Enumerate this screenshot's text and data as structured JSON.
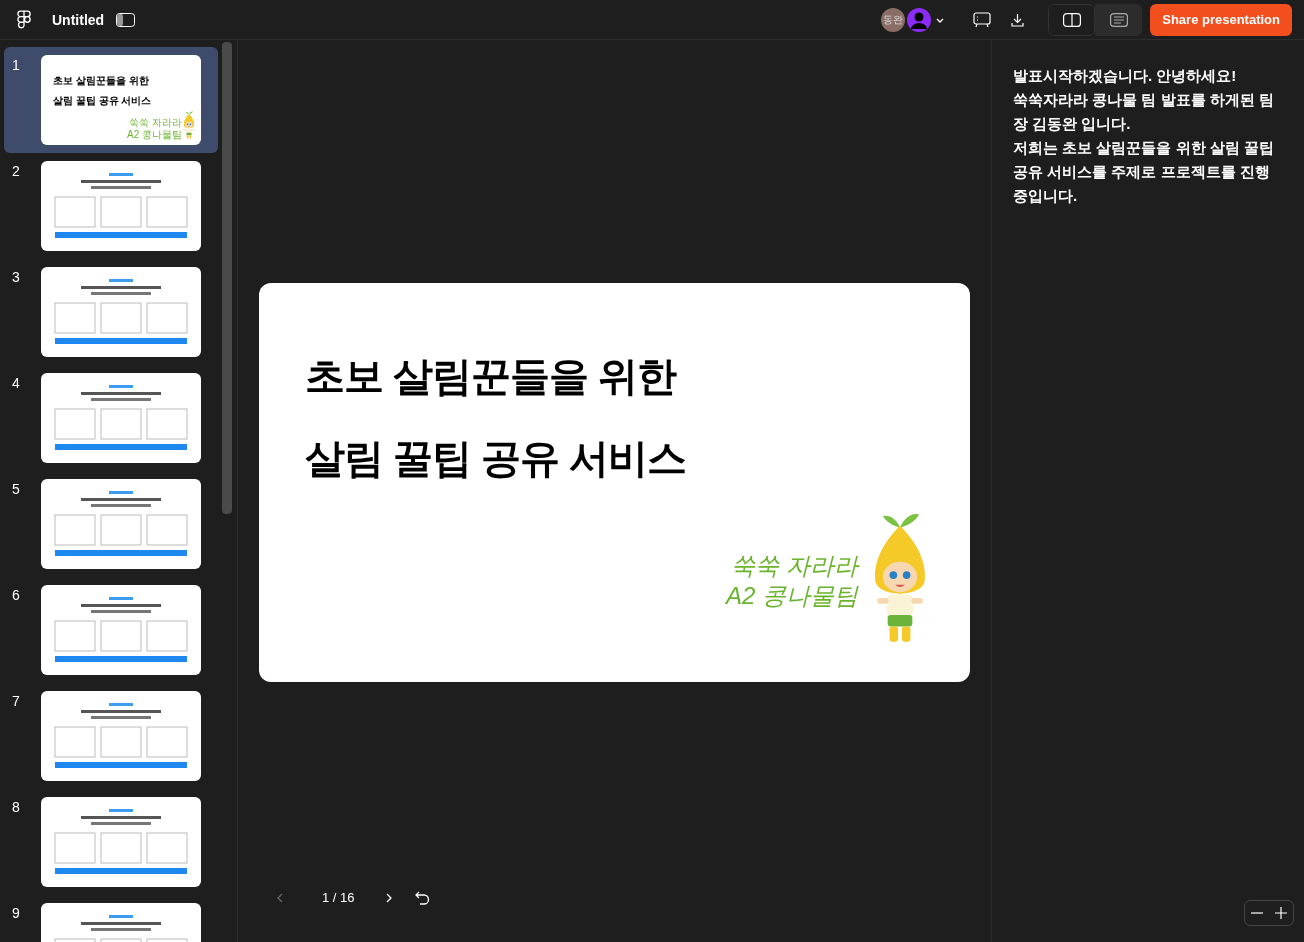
{
  "toolbar": {
    "document_title": "Untitled",
    "avatars": [
      {
        "kind": "initials",
        "label": "동완"
      },
      {
        "kind": "silhouette"
      }
    ],
    "view_modes": [
      {
        "kind": "split",
        "selected": true
      },
      {
        "kind": "notes",
        "selected": false
      }
    ],
    "share_button": "Share presentation"
  },
  "slides": [
    {
      "number": "1",
      "selected": true,
      "kind": "title",
      "lines": [
        "초보 살림꾼들을 위한",
        "살림 꿀팁 공유 서비스"
      ],
      "tagline": [
        "쑥쑥 자라라",
        "A2 콩나물팀"
      ]
    },
    {
      "number": "2",
      "selected": false,
      "kind": "content"
    },
    {
      "number": "3",
      "selected": false,
      "kind": "content"
    },
    {
      "number": "4",
      "selected": false,
      "kind": "content"
    },
    {
      "number": "5",
      "selected": false,
      "kind": "content"
    },
    {
      "number": "6",
      "selected": false,
      "kind": "content"
    },
    {
      "number": "7",
      "selected": false,
      "kind": "content"
    },
    {
      "number": "8",
      "selected": false,
      "kind": "content"
    },
    {
      "number": "9",
      "selected": false,
      "kind": "content"
    }
  ],
  "current_slide": {
    "lines": [
      "초보 살림꾼들을 위한",
      "살림 꿀팁 공유 서비스"
    ],
    "tagline": [
      "쑥쑥 자라라",
      "A2 콩나물팀"
    ]
  },
  "pager": "1 / 16",
  "notes": [
    "발표시작하겠습니다. 안녕하세요!",
    "쑥쑥자라라 콩나물 팀 발표를 하게된 팀장 김동완 입니다.",
    "저희는 초보 살림꾼들을 위한 살림 꿀팁 공유 서비스를 주제로  프로젝트를 진행중입니다."
  ]
}
